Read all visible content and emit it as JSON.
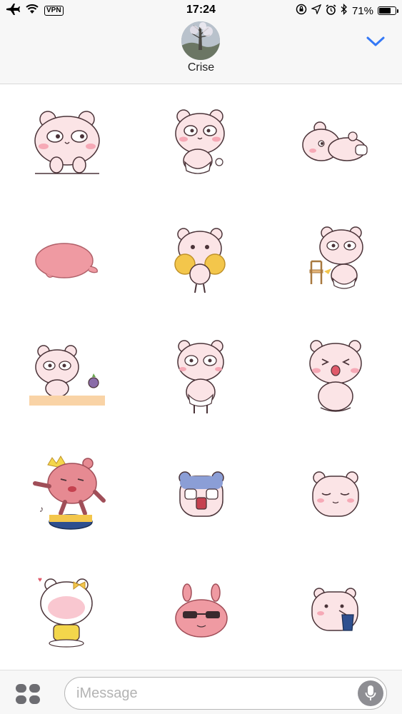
{
  "status_bar": {
    "vpn_label": "VPN",
    "time": "17:24",
    "battery_percent": "71%",
    "battery_level": 0.71,
    "icons": [
      "airplane-icon",
      "wifi-icon",
      "orientation-lock-icon",
      "location-icon",
      "alarm-icon",
      "bluetooth-icon",
      "battery-icon"
    ]
  },
  "header": {
    "contact_name": "Crise",
    "collapse_icon": "chevron-down-icon"
  },
  "stickers": [
    {
      "name": "bear-peeking-over-wall"
    },
    {
      "name": "bear-diaper-standing"
    },
    {
      "name": "bear-lying-down"
    },
    {
      "name": "pink-blob-sleeping"
    },
    {
      "name": "bear-cheerleader-pompoms"
    },
    {
      "name": "bear-with-chair"
    },
    {
      "name": "bear-at-table-with-eggplant"
    },
    {
      "name": "bear-standing-wondering"
    },
    {
      "name": "bear-sitting-laughing"
    },
    {
      "name": "bear-dancing-on-drum"
    },
    {
      "name": "bear-face-blue-ears"
    },
    {
      "name": "bear-face-content"
    },
    {
      "name": "white-bear-yellow-bow"
    },
    {
      "name": "pink-bunny-sunglasses"
    },
    {
      "name": "bear-drinking-cup"
    }
  ],
  "colors": {
    "accent": "#3478f6",
    "bear_pink": "#fbe4e6",
    "blob_pink": "#ef9aa2",
    "outline": "#4a3338"
  },
  "compose": {
    "placeholder": "iMessage",
    "value": ""
  }
}
